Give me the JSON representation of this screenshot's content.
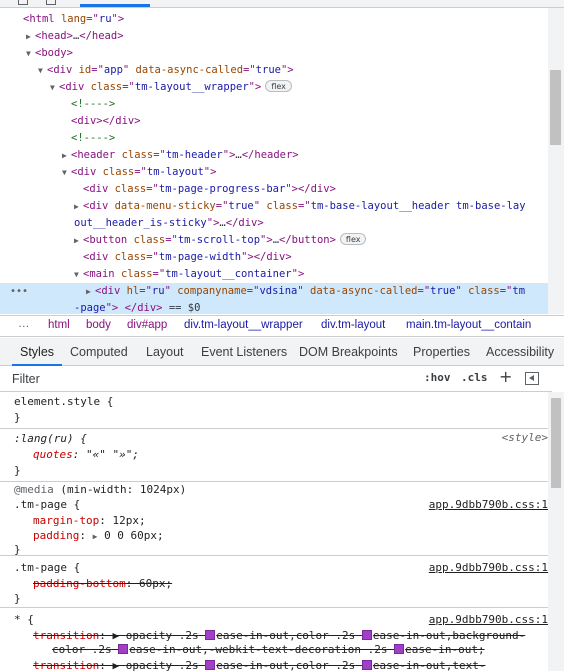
{
  "dom_tree": {
    "lines": [
      {
        "indent": 1,
        "tri": "",
        "parts": [
          [
            "tag",
            "<html "
          ],
          [
            "attr",
            "lang"
          ],
          [
            "tag",
            "=\""
          ],
          [
            "val",
            "ru"
          ],
          [
            "tag",
            "\">"
          ]
        ]
      },
      {
        "indent": 2,
        "tri": "▶",
        "parts": [
          [
            "tag",
            "<head>"
          ],
          [
            "txt",
            "…"
          ],
          [
            "tag",
            "</head>"
          ]
        ]
      },
      {
        "indent": 2,
        "tri": "▼",
        "parts": [
          [
            "tag",
            "<body>"
          ]
        ]
      },
      {
        "indent": 3,
        "tri": "▼",
        "parts": [
          [
            "tag",
            "<div "
          ],
          [
            "attr",
            "id"
          ],
          [
            "tag",
            "=\""
          ],
          [
            "val",
            "app"
          ],
          [
            "tag",
            "\" "
          ],
          [
            "attr",
            "data-async-called"
          ],
          [
            "tag",
            "=\""
          ],
          [
            "val",
            "true"
          ],
          [
            "tag",
            "\">"
          ]
        ]
      },
      {
        "indent": 4,
        "tri": "▼",
        "parts": [
          [
            "tag",
            "<div "
          ],
          [
            "attr",
            "class"
          ],
          [
            "tag",
            "=\""
          ],
          [
            "val",
            "tm-layout__wrapper"
          ],
          [
            "tag",
            "\">"
          ]
        ],
        "badge": "flex"
      },
      {
        "indent": 5,
        "tri": "",
        "parts": [
          [
            "cmt",
            "<!---->"
          ]
        ]
      },
      {
        "indent": 5,
        "tri": "",
        "parts": [
          [
            "tag",
            "<div></div>"
          ]
        ]
      },
      {
        "indent": 5,
        "tri": "",
        "parts": [
          [
            "cmt",
            "<!---->"
          ]
        ]
      },
      {
        "indent": 5,
        "tri": "▶",
        "parts": [
          [
            "tag",
            "<header "
          ],
          [
            "attr",
            "class"
          ],
          [
            "tag",
            "=\""
          ],
          [
            "val",
            "tm-header"
          ],
          [
            "tag",
            "\">"
          ],
          [
            "txt",
            "…"
          ],
          [
            "tag",
            "</header>"
          ]
        ]
      },
      {
        "indent": 5,
        "tri": "▼",
        "parts": [
          [
            "tag",
            "<div "
          ],
          [
            "attr",
            "class"
          ],
          [
            "tag",
            "=\""
          ],
          [
            "val",
            "tm-layout"
          ],
          [
            "tag",
            "\">"
          ]
        ]
      },
      {
        "indent": 6,
        "tri": "",
        "parts": [
          [
            "tag",
            "<div "
          ],
          [
            "attr",
            "class"
          ],
          [
            "tag",
            "=\""
          ],
          [
            "val",
            "tm-page-progress-bar"
          ],
          [
            "tag",
            "\"></div>"
          ]
        ]
      },
      {
        "indent": 6,
        "tri": "▶",
        "parts": [
          [
            "tag",
            "<div "
          ],
          [
            "attr",
            "data-menu-sticky"
          ],
          [
            "tag",
            "=\""
          ],
          [
            "val",
            "true"
          ],
          [
            "tag",
            "\" "
          ],
          [
            "attr",
            "class"
          ],
          [
            "tag",
            "=\""
          ],
          [
            "val",
            "tm-base-layout__header tm-base-lay"
          ]
        ]
      },
      {
        "indent": 0,
        "tri": "",
        "cont": true,
        "parts": [
          [
            "val",
            "out__header_is-sticky"
          ],
          [
            "tag",
            "\">"
          ],
          [
            "txt",
            "…"
          ],
          [
            "tag",
            "</div>"
          ]
        ]
      },
      {
        "indent": 6,
        "tri": "▶",
        "parts": [
          [
            "tag",
            "<button "
          ],
          [
            "attr",
            "class"
          ],
          [
            "tag",
            "=\""
          ],
          [
            "val",
            "tm-scroll-top"
          ],
          [
            "tag",
            "\">"
          ],
          [
            "txt",
            "…"
          ],
          [
            "tag",
            "</button>"
          ]
        ],
        "badge": "flex"
      },
      {
        "indent": 6,
        "tri": "",
        "parts": [
          [
            "tag",
            "<div "
          ],
          [
            "attr",
            "class"
          ],
          [
            "tag",
            "=\""
          ],
          [
            "val",
            "tm-page-width"
          ],
          [
            "tag",
            "\"></div>"
          ]
        ]
      },
      {
        "indent": 6,
        "tri": "▼",
        "parts": [
          [
            "tag",
            "<main "
          ],
          [
            "attr",
            "class"
          ],
          [
            "tag",
            "=\""
          ],
          [
            "val",
            "tm-layout__container"
          ],
          [
            "tag",
            "\">"
          ]
        ]
      },
      {
        "indent": 7,
        "tri": "▶",
        "selected": true,
        "parts": [
          [
            "tag",
            "<div "
          ],
          [
            "attr",
            "hl"
          ],
          [
            "tag",
            "=\""
          ],
          [
            "val",
            "ru"
          ],
          [
            "tag",
            "\" "
          ],
          [
            "attr",
            "companyname"
          ],
          [
            "tag",
            "=\""
          ],
          [
            "val",
            "vdsina"
          ],
          [
            "tag",
            "\" "
          ],
          [
            "attr",
            "data-async-called"
          ],
          [
            "tag",
            "=\""
          ],
          [
            "val",
            "true"
          ],
          [
            "tag",
            "\" "
          ],
          [
            "attr",
            "class"
          ],
          [
            "tag",
            "=\""
          ],
          [
            "val",
            "tm"
          ]
        ]
      },
      {
        "indent": 0,
        "tri": "",
        "cont": true,
        "selected": true,
        "parts": [
          [
            "val",
            "-page"
          ],
          [
            "tag",
            "\"> </div> "
          ],
          [
            "txt",
            "== $0"
          ]
        ]
      }
    ],
    "selected_dots": "•••"
  },
  "breadcrumb": {
    "more": "…",
    "items": [
      {
        "label": "html",
        "kind": "tag"
      },
      {
        "label": "body",
        "kind": "tag"
      },
      {
        "label": "div#app",
        "kind": "tag"
      },
      {
        "label": "div.tm-layout__wrapper",
        "kind": "cls"
      },
      {
        "label": "div.tm-layout",
        "kind": "cls"
      },
      {
        "label": "main.tm-layout__contain",
        "kind": "cls"
      }
    ]
  },
  "tabs": [
    "Styles",
    "Computed",
    "Layout",
    "Event Listeners",
    "DOM Breakpoints",
    "Properties",
    "Accessibility"
  ],
  "active_tab": "Styles",
  "filter": {
    "placeholder": "Filter",
    "value": "",
    "hov": ":hov",
    "cls": ".cls",
    "plus": "+"
  },
  "styles": {
    "element_style": {
      "selector": "element.style {",
      "close": "}"
    },
    "lang_rule": {
      "selector": ":lang(ru) {",
      "origin": "<style>",
      "prop": "quotes",
      "value": "\"«\" \"»\";",
      "close": "}"
    },
    "media_rule": {
      "media": "@media",
      "media_query": "(min-width: 1024px)",
      "selector": ".tm-page {",
      "origin": "app.9dbb790b.css:1",
      "props": [
        {
          "name": "margin-top",
          "value": "12px;"
        },
        {
          "name": "padding",
          "value": "0 0 60px;",
          "expand": "▶"
        }
      ],
      "close": "}"
    },
    "page_rule": {
      "selector": ".tm-page {",
      "origin": "app.9dbb790b.css:1",
      "prop": "padding-bottom",
      "value": "60px;",
      "close": "}"
    },
    "universal_rule": {
      "selector": "* {",
      "origin": "app.9dbb790b.css:1",
      "line1": {
        "name": "transition",
        "value_a": "opacity .2s",
        "value_b": "ease-in-out,color .2s",
        "value_c": "ease-in-out,background-"
      },
      "line2": {
        "value_a": "color .2s",
        "value_b": "ease-in-out,-webkit-text-decoration .2s",
        "value_c": "ease-in-out;"
      },
      "line3": {
        "name": "transition",
        "value_a": "opacity .2s",
        "value_b": "ease-in-out,color .2s",
        "value_c": "ease-in-out,text-"
      }
    }
  },
  "colors": {
    "accent": "#1a73e8",
    "selected_row": "#cfe8fc",
    "tag": "#881280",
    "attr": "#994500",
    "value": "#1a1aa6",
    "comment": "#236e25",
    "prop": "#c80000"
  }
}
